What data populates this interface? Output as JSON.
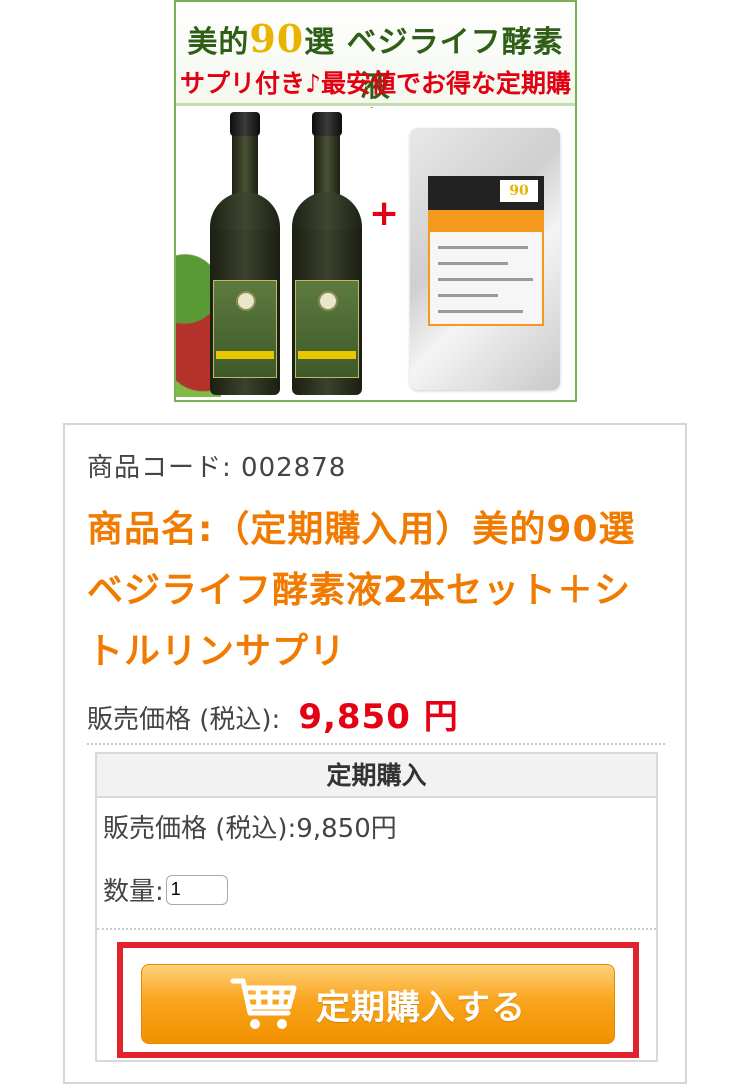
{
  "product_image": {
    "banner_title_prefix": "美的",
    "banner_title_number": "90",
    "banner_title_suffix": "選 ベジライフ酵素液",
    "banner_subtitle": "サプリ付き♪最安値でお得な定期購入",
    "plus_sign": "+",
    "pouch_badge": "90"
  },
  "product": {
    "code_label": "商品コード: 002878",
    "name": "商品名:（定期購入用）美的90選　ベジライフ酵素液2本セット＋シトルリンサプリ",
    "price_label": "販売価格 (税込):",
    "price_value": "9,850 円"
  },
  "subscription": {
    "header": "定期購入",
    "price_text": "販売価格 (税込):9,850円",
    "quantity_label": "数量:",
    "quantity_value": "1",
    "buy_button_label": "定期購入する"
  },
  "colors": {
    "accent_orange": "#f07b00",
    "price_red": "#e60012",
    "button_orange": "#f29100",
    "highlight_red": "#e0232c"
  },
  "icons": {
    "cart": "shopping-cart-icon"
  }
}
